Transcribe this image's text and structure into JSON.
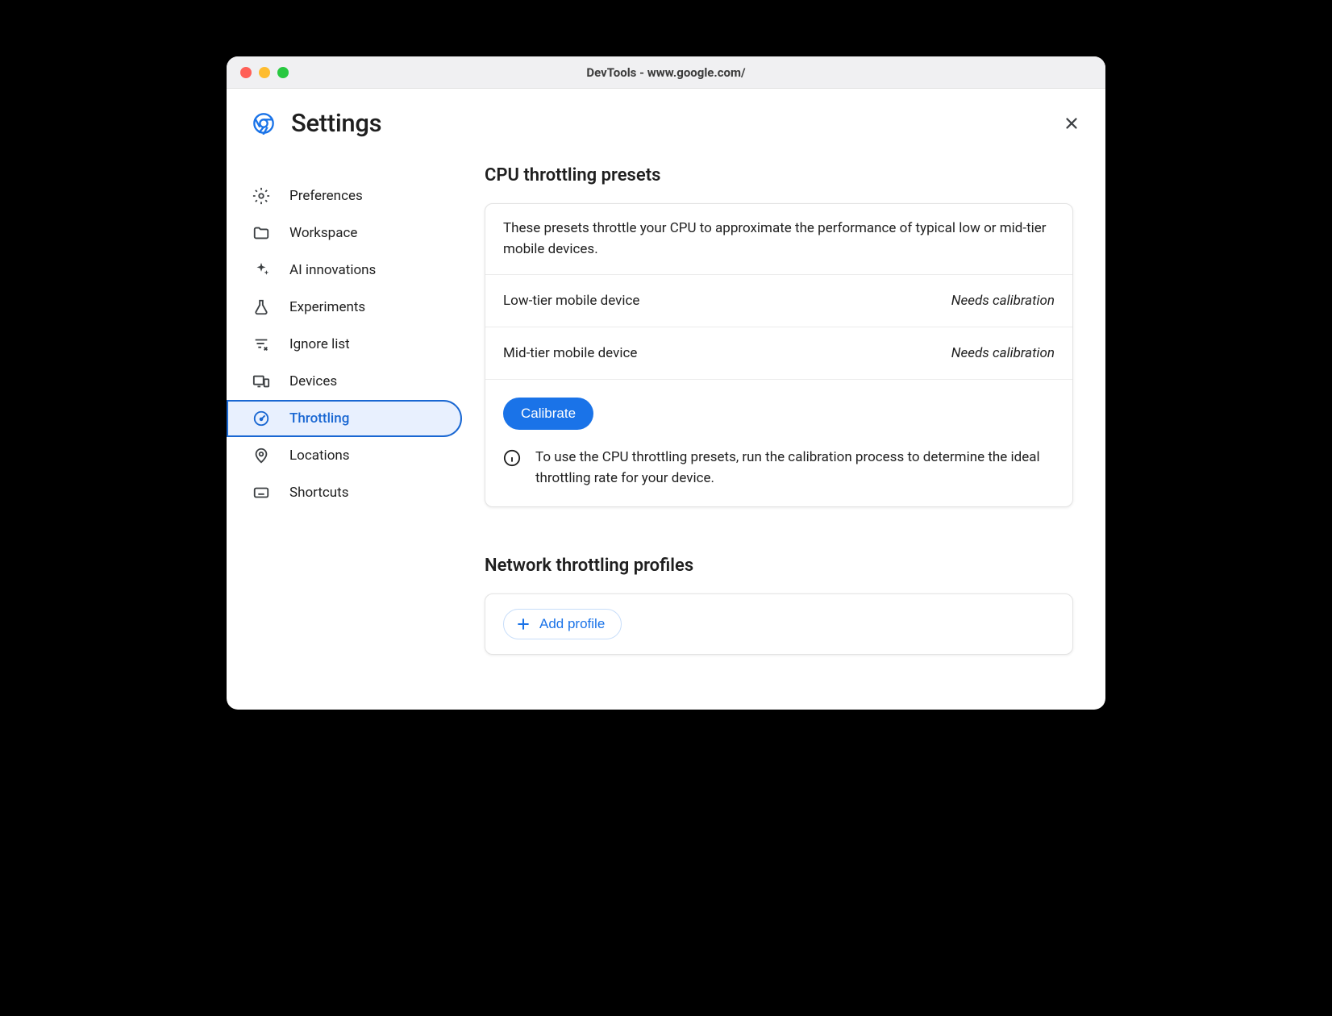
{
  "window": {
    "title": "DevTools - www.google.com/"
  },
  "header": {
    "title": "Settings"
  },
  "sidebar": {
    "items": [
      {
        "label": "Preferences",
        "icon": "gear-icon"
      },
      {
        "label": "Workspace",
        "icon": "folder-icon"
      },
      {
        "label": "AI innovations",
        "icon": "sparkle-icon"
      },
      {
        "label": "Experiments",
        "icon": "flask-icon"
      },
      {
        "label": "Ignore list",
        "icon": "filter-x-icon"
      },
      {
        "label": "Devices",
        "icon": "devices-icon"
      },
      {
        "label": "Throttling",
        "icon": "gauge-icon",
        "selected": true
      },
      {
        "label": "Locations",
        "icon": "pin-icon"
      },
      {
        "label": "Shortcuts",
        "icon": "keyboard-icon"
      }
    ]
  },
  "cpu_section": {
    "heading": "CPU throttling presets",
    "description": "These presets throttle your CPU to approximate the performance of typical low or mid-tier mobile devices.",
    "presets": [
      {
        "name": "Low-tier mobile device",
        "status": "Needs calibration"
      },
      {
        "name": "Mid-tier mobile device",
        "status": "Needs calibration"
      }
    ],
    "calibrate_label": "Calibrate",
    "info_text": "To use the CPU throttling presets, run the calibration process to determine the ideal throttling rate for your device."
  },
  "network_section": {
    "heading": "Network throttling profiles",
    "add_profile_label": "Add profile"
  }
}
